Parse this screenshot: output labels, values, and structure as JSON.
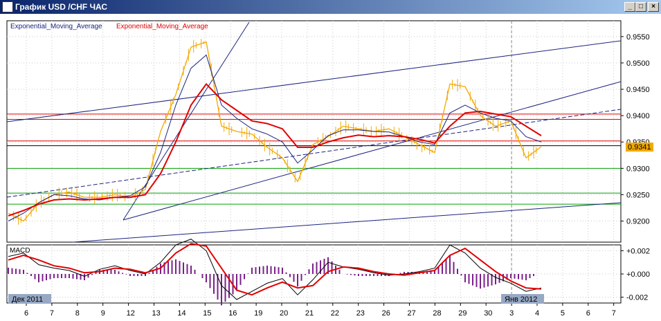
{
  "window": {
    "title": "График USD /CHF ЧАС",
    "minimize_glyph": "_",
    "maximize_glyph": "□",
    "close_glyph": "×"
  },
  "legend": {
    "ema_fast_label": "Exponential_Moving_Average",
    "ema_slow_label": "Exponential_Moving_Average"
  },
  "macd": {
    "label": "MACD"
  },
  "colors": {
    "price": "#f2a900",
    "ema_fast": "#1a237e",
    "ema_slow": "#e00000",
    "trend": "#1a237e",
    "resistance": "#e00000",
    "support": "#00a000",
    "histogram": "#7b1f8a",
    "grid": "#c8c8c8",
    "tag_bg": "#97a8c4",
    "price_tag_bg": "#f2a900"
  },
  "chart_data": [
    {
      "type": "line",
      "title": "",
      "x_tick_labels": [
        "6",
        "7",
        "8",
        "9",
        "12",
        "13",
        "14",
        "15",
        "16",
        "19",
        "20",
        "21",
        "22",
        "23",
        "26",
        "27",
        "28",
        "29",
        "30",
        "3",
        "4",
        "5",
        "6",
        "7"
      ],
      "month_tags": [
        "Дек 2011",
        "Янв 2012"
      ],
      "y_tick_labels": [
        "0.9550",
        "0.9500",
        "0.9450",
        "0.9400",
        "0.9350",
        "0.9300",
        "0.9250",
        "0.9200"
      ],
      "ylim": [
        0.916,
        0.958
      ],
      "y_ticks": [
        0.955,
        0.95,
        0.945,
        0.94,
        0.935,
        0.93,
        0.925,
        0.92
      ],
      "current_price_label": "0.9341",
      "current_price": 0.9341,
      "series": [
        {
          "values": [
            0.9215,
            0.92,
            0.9235,
            0.925,
            0.9255,
            0.9245,
            0.9245,
            0.925,
            0.9245,
            0.926,
            0.937,
            0.944,
            0.953,
            0.954,
            0.938,
            0.937,
            0.9365,
            0.934,
            0.932,
            0.9275,
            0.9345,
            0.936,
            0.938,
            0.9375,
            0.937,
            0.9375,
            0.936,
            0.9345,
            0.933,
            0.946,
            0.9455,
            0.94,
            0.938,
            0.939,
            0.932,
            0.9341
          ]
        },
        {
          "values": [
            0.92,
            0.9215,
            0.9235,
            0.925,
            0.9248,
            0.9242,
            0.924,
            0.9245,
            0.9248,
            0.9265,
            0.933,
            0.942,
            0.949,
            0.9515,
            0.942,
            0.9395,
            0.9375,
            0.9365,
            0.935,
            0.931,
            0.9335,
            0.9362,
            0.9373,
            0.9373,
            0.937,
            0.9369,
            0.936,
            0.935,
            0.9345,
            0.9405,
            0.942,
            0.9405,
            0.9395,
            0.939,
            0.936,
            0.935
          ]
        },
        {
          "values": [
            0.921,
            0.922,
            0.9232,
            0.924,
            0.9242,
            0.924,
            0.9242,
            0.9245,
            0.9245,
            0.925,
            0.929,
            0.935,
            0.942,
            0.946,
            0.943,
            0.941,
            0.939,
            0.9385,
            0.9375,
            0.934,
            0.934,
            0.935,
            0.9358,
            0.9363,
            0.936,
            0.9362,
            0.936,
            0.9355,
            0.9348,
            0.938,
            0.9405,
            0.9408,
            0.9403,
            0.9398,
            0.938,
            0.9362
          ]
        }
      ],
      "horizontal_levels": {
        "red": [
          0.9403,
          0.9393,
          0.9352
        ],
        "black": [
          0.9343
        ],
        "green": [
          0.93,
          0.9253,
          0.9232
        ]
      }
    },
    {
      "type": "line",
      "title": "",
      "y_tick_labels": [
        "+0.002",
        "+0.000",
        "-0.002"
      ],
      "ylim": [
        -0.0025,
        0.0025
      ],
      "y_ticks": [
        0.002,
        0.0,
        -0.002
      ],
      "series": [
        {
          "values": [
            0.0015,
            0.0018,
            0.0008,
            0.0005,
            0.0003,
            -0.0002,
            0.0004,
            0.0007,
            0.0003,
            0.0,
            0.001,
            0.0025,
            0.003,
            0.002,
            -0.001,
            -0.0022,
            -0.0015,
            -0.0008,
            -0.0004,
            -0.0018,
            -0.0005,
            0.001,
            0.0006,
            0.0004,
            0.0001,
            -0.0001,
            0.0,
            0.0002,
            0.0005,
            0.0025,
            0.0018,
            0.0005,
            -0.0003,
            -0.0008,
            -0.0015,
            -0.0012
          ]
        },
        {
          "values": [
            0.0012,
            0.0016,
            0.0012,
            0.0007,
            0.0005,
            0.0001,
            0.0002,
            0.0005,
            0.0004,
            0.0001,
            0.0005,
            0.0018,
            0.0026,
            0.0024,
            0.0005,
            -0.0014,
            -0.0018,
            -0.0012,
            -0.0007,
            -0.0012,
            -0.001,
            0.0002,
            0.0006,
            0.0005,
            0.0002,
            0.0,
            -0.0001,
            0.0001,
            0.0003,
            0.0016,
            0.0022,
            0.0012,
            0.0002,
            -0.0006,
            -0.0012,
            -0.0013
          ]
        }
      ]
    }
  ]
}
